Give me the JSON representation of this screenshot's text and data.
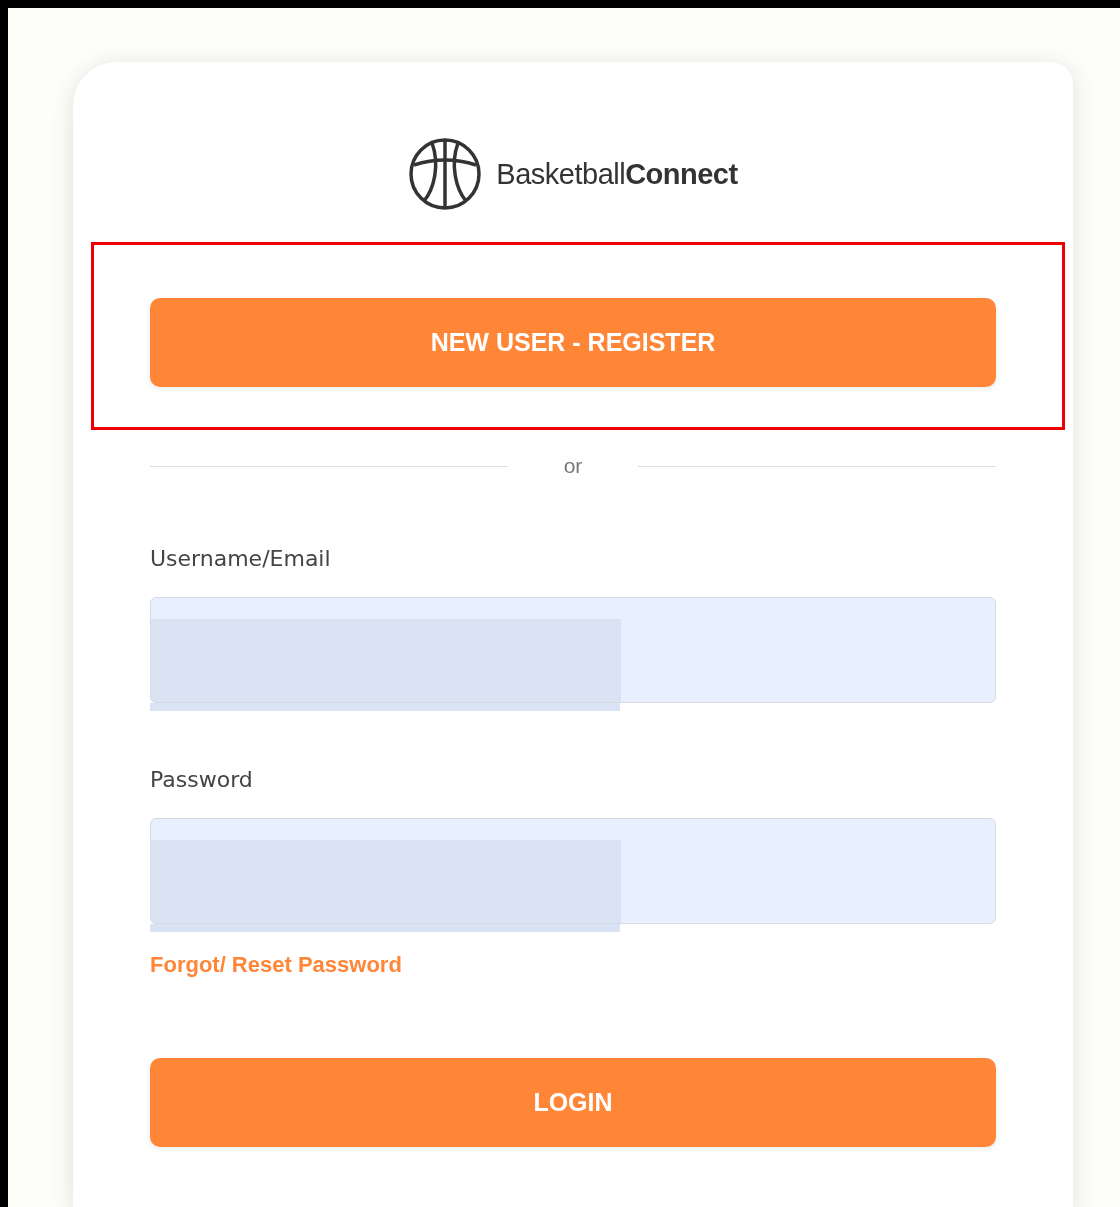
{
  "logo": {
    "text": "Basketball**Connect**"
  },
  "register_button": {
    "label": "NEW USER - REGISTER",
    "highlighted": true
  },
  "divider": {
    "label": "or"
  },
  "fields": [
    {
      "label": "Username/Email",
      "redacted": true
    },
    {
      "label": "Password",
      "redacted": true
    }
  ],
  "forgot_link": "Forgot/ Reset Password",
  "login_button": {
    "label": "LOGIN"
  }
}
